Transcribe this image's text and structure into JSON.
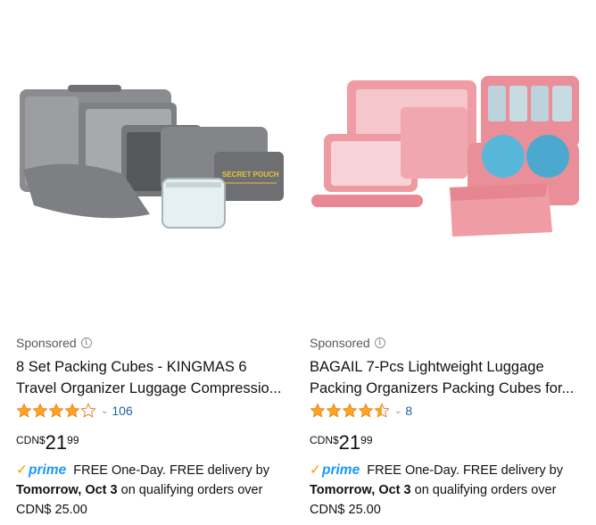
{
  "products": [
    {
      "sponsored_label": "Sponsored",
      "title_line1": "8 Set Packing Cubes - KINGMAS 6",
      "title_line2": "Travel Organizer Luggage Compressio...",
      "rating_stars": 4,
      "review_count": "106",
      "price_currency": "CDN$",
      "price_whole": "21",
      "price_fraction": "99",
      "prime_label": "prime",
      "delivery_line1": "FREE One-Day. FREE delivery by",
      "delivery_date": "Tomorrow, Oct 3",
      "delivery_line2_rest": "on qualifying orders over",
      "delivery_threshold": "CDN$ 25.00",
      "image_caption": "SECRET POUCH"
    },
    {
      "sponsored_label": "Sponsored",
      "title_line1": "BAGAIL 7-Pcs Lightweight Luggage",
      "title_line2": "Packing Organizers Packing Cubes for...",
      "rating_stars": 4.5,
      "review_count": "8",
      "price_currency": "CDN$",
      "price_whole": "21",
      "price_fraction": "99",
      "prime_label": "prime",
      "delivery_line1": "FREE One-Day. FREE delivery by",
      "delivery_date": "Tomorrow, Oct 3",
      "delivery_line2_rest": "on qualifying orders over",
      "delivery_threshold": "CDN$ 25.00"
    }
  ],
  "colors": {
    "star": "#ffa41c",
    "link": "#2162a1",
    "prime_blue": "#1a98ff",
    "prime_check": "#ff9900",
    "gray_cube": "#8b8d90",
    "pink_cube": "#ee9aa3"
  }
}
